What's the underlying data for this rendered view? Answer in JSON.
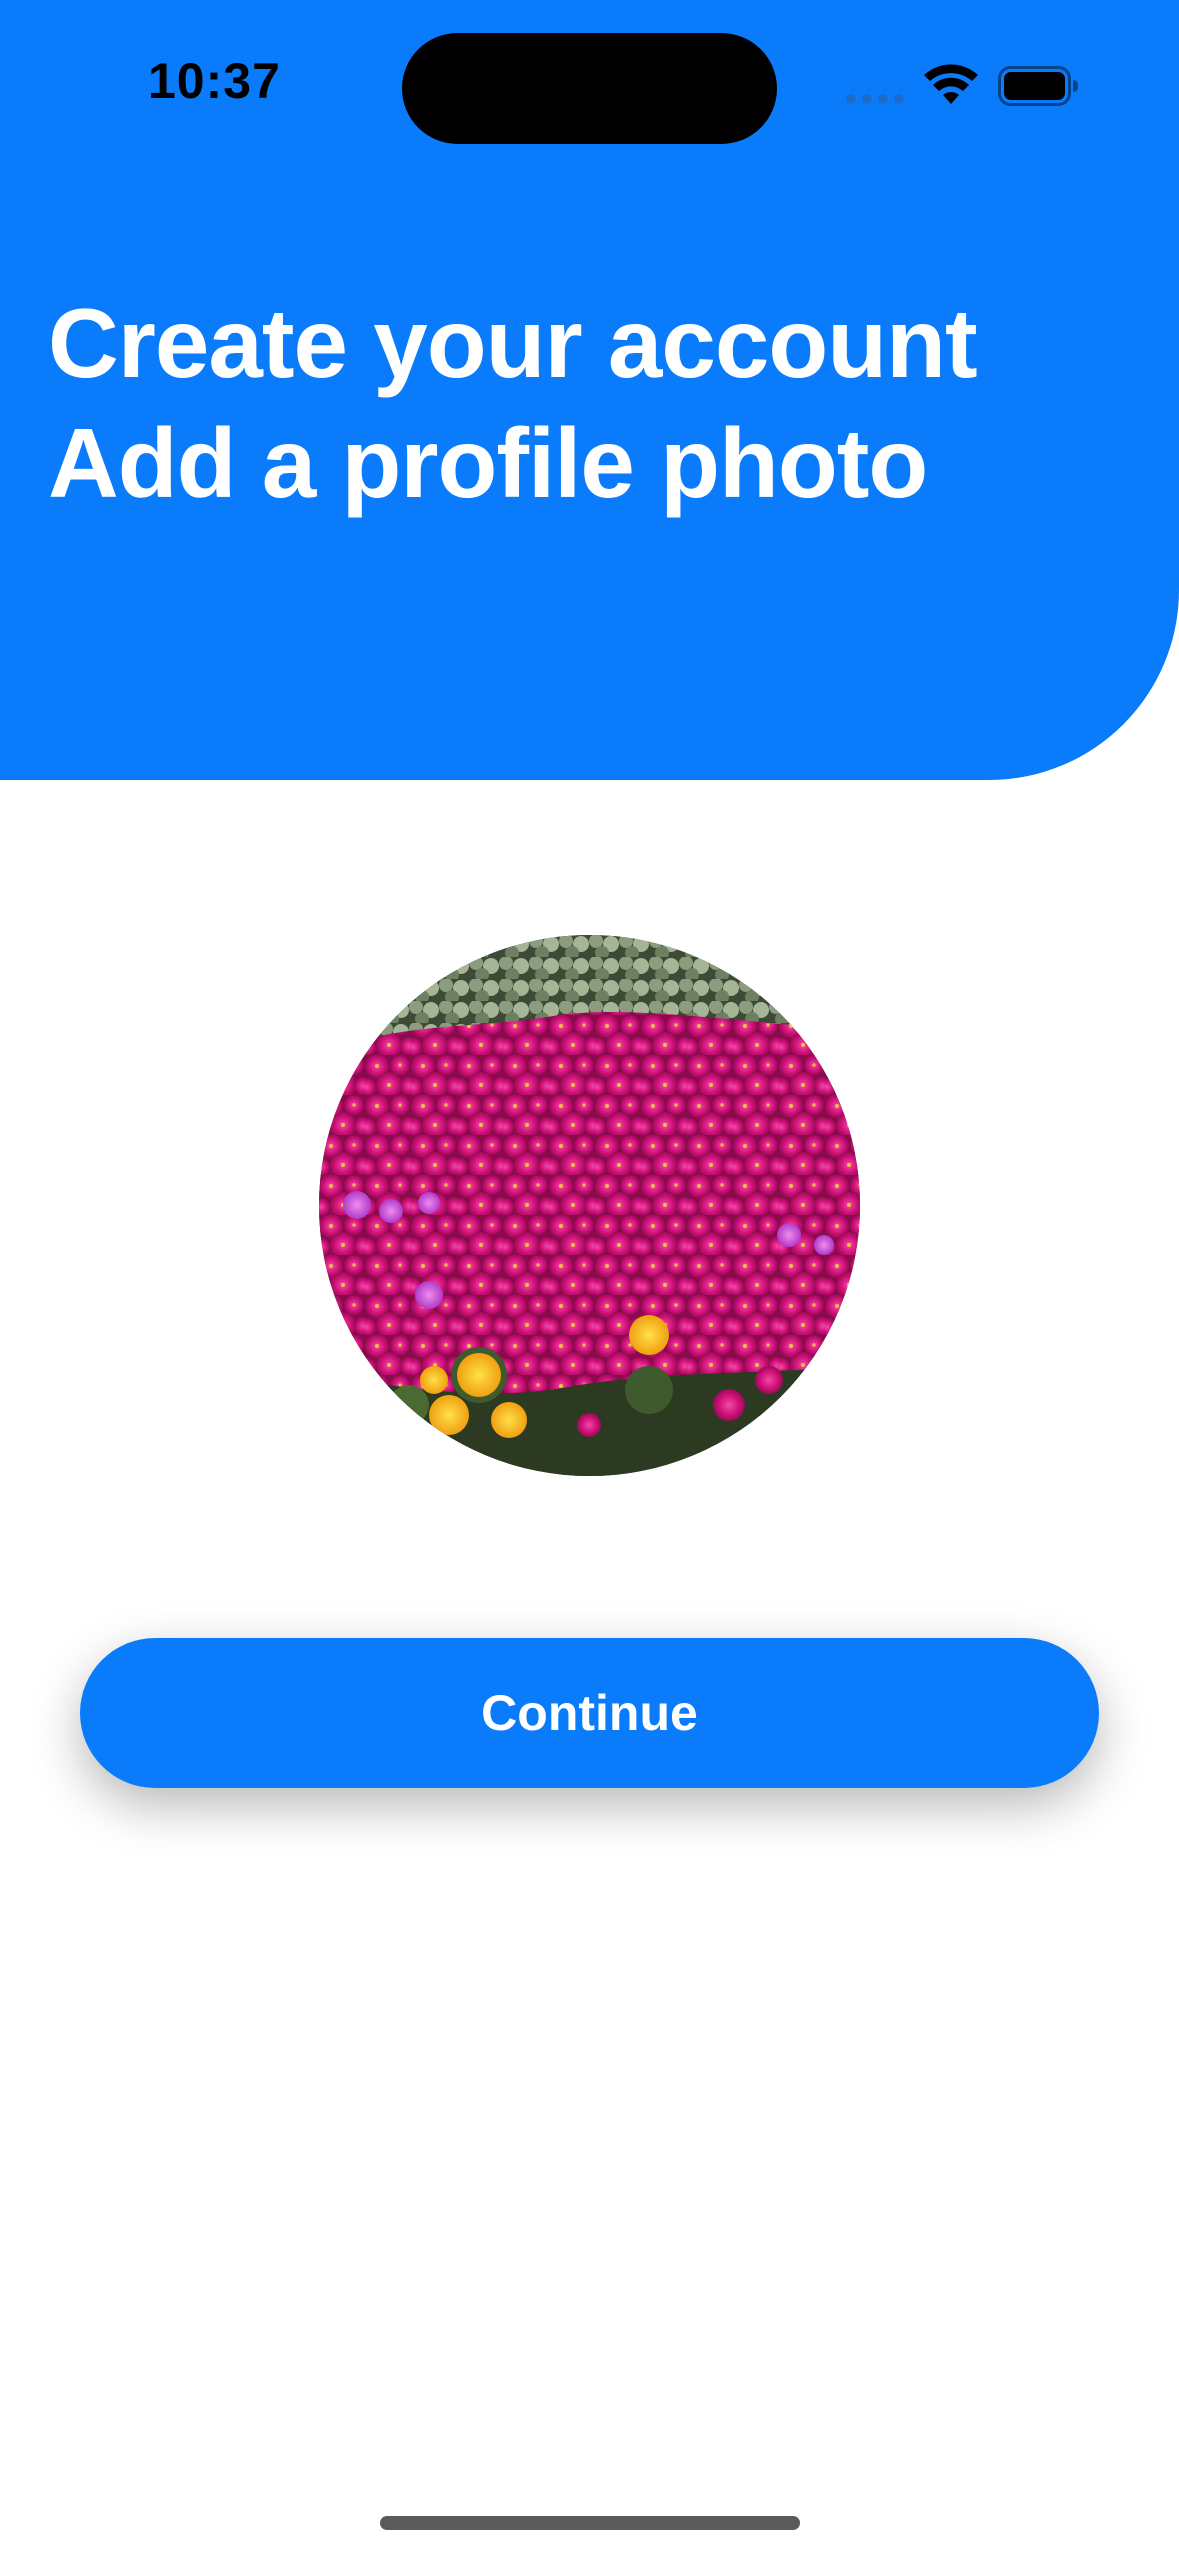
{
  "status_bar": {
    "time": "10:37",
    "signal_icon": "cellular-signal-icon",
    "wifi_icon": "wifi-icon",
    "battery_icon": "battery-icon",
    "battery_level": 1.0
  },
  "header": {
    "title_line_1": "Create your account",
    "title_line_2": "Add a profile photo"
  },
  "profile_photo": {
    "icon": "flowers-photo",
    "subject": "field of magenta and yellow flowers"
  },
  "actions": {
    "continue_label": "Continue"
  },
  "colors": {
    "accent": "#0a7cfb",
    "background": "#ffffff",
    "header_text": "#ffffff"
  }
}
